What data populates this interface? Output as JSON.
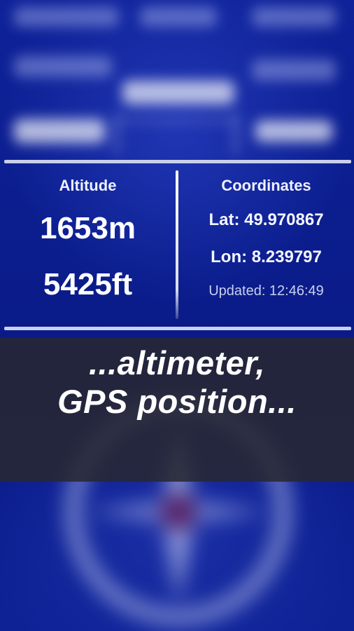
{
  "altitude": {
    "heading": "Altitude",
    "meters": "1653m",
    "feet": "5425ft"
  },
  "coordinates": {
    "heading": "Coordinates",
    "lat": "Lat: 49.970867",
    "lon": "Lon: 8.239797",
    "updated": "Updated: 12:46:49"
  },
  "caption": {
    "line1": "...altimeter,",
    "line2": "GPS position..."
  },
  "colors": {
    "background": "#0b1f8f",
    "text": "#ffffff",
    "divider": "#c9d0ec",
    "caption_band": "#28282f"
  }
}
